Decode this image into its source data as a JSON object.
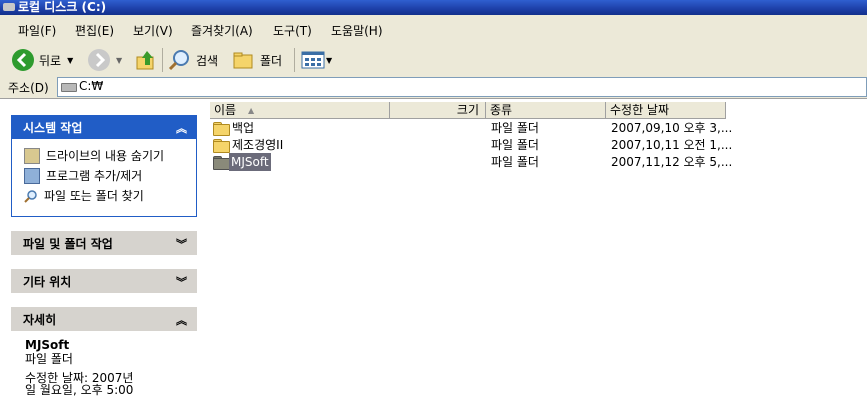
{
  "window": {
    "title": "로컬 디스크 (C:)"
  },
  "menu": [
    "파일(F)",
    "편집(E)",
    "보기(V)",
    "즐겨찾기(A)",
    "도구(T)",
    "도움말(H)"
  ],
  "toolbar": {
    "back_label": "뒤로",
    "search_label": "검색",
    "folders_label": "폴더"
  },
  "address": {
    "label": "주소(D)",
    "value": "C:₩"
  },
  "left_pane": {
    "system_tasks": {
      "title": "시스템 작업",
      "items": [
        "드라이브의 내용 숨기기",
        "프로그램 추가/제거",
        "파일 또는 폴더 찾기"
      ]
    },
    "file_folder_tasks": {
      "title": "파일 및 폴더 작업"
    },
    "other_places": {
      "title": "기타 위치"
    },
    "details": {
      "title": "자세히",
      "name": "MJSoft",
      "type": "파일 폴더",
      "modified_line1": "수정한 날짜: 2007년",
      "modified_line2": "일 월요일, 오후 5:00"
    }
  },
  "file_list": {
    "columns": {
      "name": "이름",
      "size": "크기",
      "type": "종류",
      "modified": "수정한 날짜"
    },
    "rows": [
      {
        "name": "백업",
        "type": "파일 폴더",
        "modified": "2007,09,10 오후 3,..."
      },
      {
        "name": "제조경영II",
        "type": "파일 폴더",
        "modified": "2007,10,11 오전 1,..."
      },
      {
        "name": "MJSoft",
        "type": "파일 폴더",
        "modified": "2007,11,12 오후 5,..."
      }
    ],
    "selected_index": 2
  },
  "colors": {
    "title_bar": "#1d3fa8",
    "task_header": "#215dc6",
    "chrome": "#ece9d8",
    "folder": "#f5d46a"
  }
}
